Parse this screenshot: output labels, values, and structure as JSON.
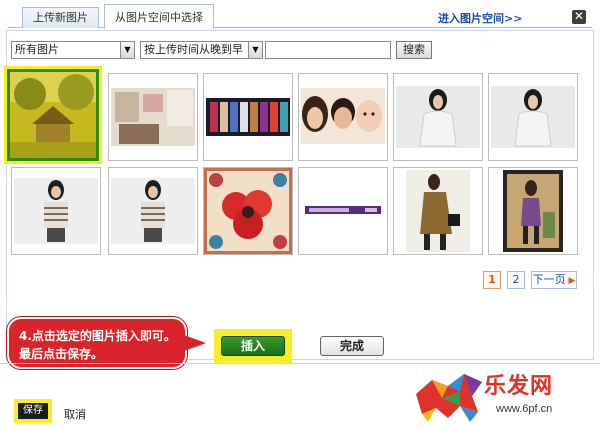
{
  "tabs": [
    {
      "label": "上传新图片",
      "active": false
    },
    {
      "label": "从图片空间中选择",
      "active": true
    }
  ],
  "header": {
    "space_link": "进入图片空间>>",
    "close": "✕"
  },
  "filters": {
    "category": "所有图片",
    "sort": "按上传时间从晚到早",
    "search_value": "",
    "search_button": "搜索"
  },
  "images": [
    {
      "name": "yellow-house",
      "selected": true
    },
    {
      "name": "room-interior",
      "selected": false
    },
    {
      "name": "banner-strip",
      "selected": false
    },
    {
      "name": "faces-portraits",
      "selected": false
    },
    {
      "name": "woman-dark-hair-1",
      "selected": false
    },
    {
      "name": "woman-dark-hair-2",
      "selected": false
    },
    {
      "name": "woman-striped-sweater-1",
      "selected": false
    },
    {
      "name": "woman-striped-sweater-2",
      "selected": false
    },
    {
      "name": "red-flower-tile",
      "selected": false
    },
    {
      "name": "purple-banner",
      "selected": false
    },
    {
      "name": "model-coat",
      "selected": false
    },
    {
      "name": "model-room",
      "selected": false
    }
  ],
  "pager": {
    "pages": [
      "1",
      "2"
    ],
    "current": "1",
    "next": "下一页"
  },
  "callout": {
    "text": "4.点击选定的图片插入即可。最后点击保存。"
  },
  "actions": {
    "insert": "插入",
    "done": "完成"
  },
  "footer": {
    "save": "保存",
    "cancel": "取消"
  },
  "logo": {
    "name": "乐发网",
    "url": "www.6pf.cn"
  },
  "colors": {
    "highlight": "#f7ee2a",
    "insert_green": "#2a8a1e",
    "callout_red": "#d8242a",
    "link_blue": "#1b4fa0"
  }
}
